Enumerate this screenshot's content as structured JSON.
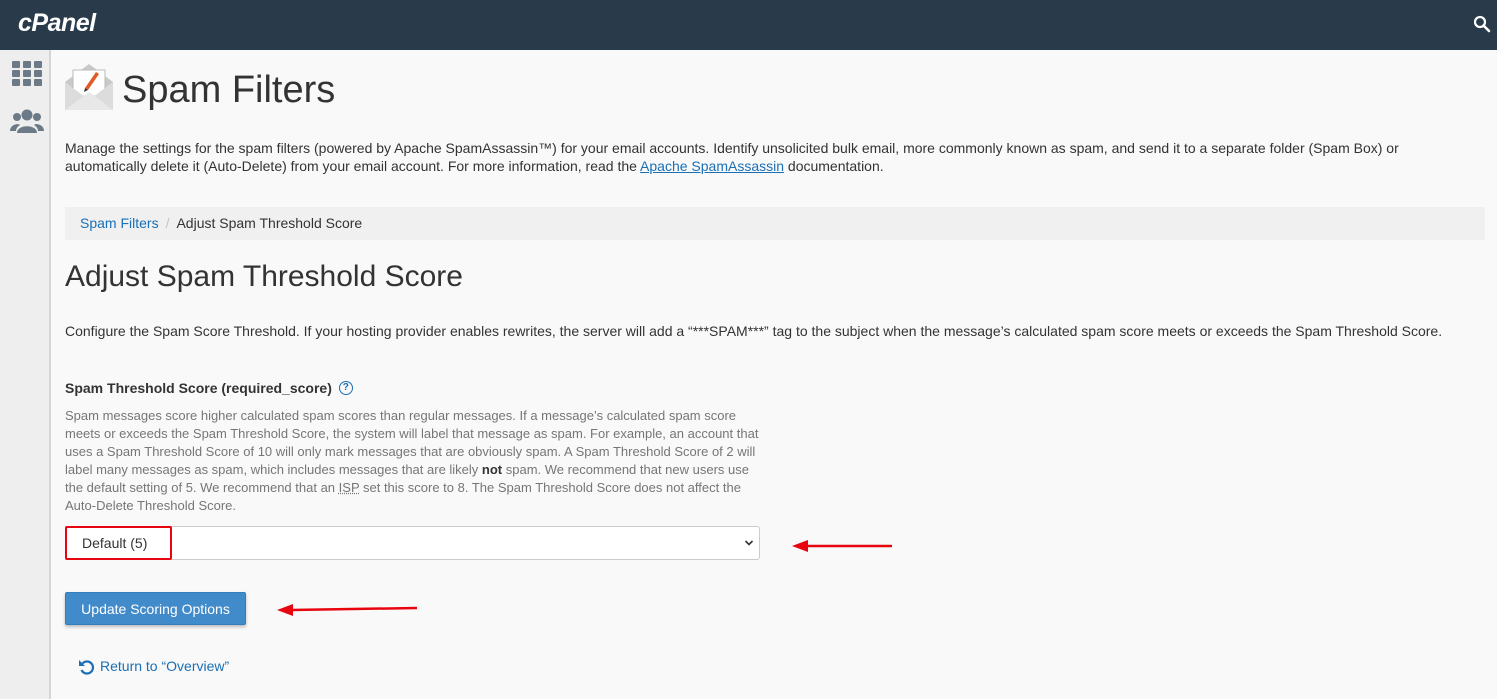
{
  "topbar": {
    "logo": "cPanel",
    "search_icon": "search-icon"
  },
  "sidebar": {
    "icons": [
      "grid-icon",
      "users-icon"
    ]
  },
  "page": {
    "title": "Spam Filters",
    "icon": "envelope-spam-icon",
    "intro_text": "Manage the settings for the spam filters (powered by Apache SpamAssassin™) for your email accounts. Identify unsolicited bulk email, more commonly known as spam, and send it to a separate folder (Spam Box) or automatically delete it (Auto-Delete) from your email account. For more information, read the ",
    "intro_link": "Apache SpamAssassin",
    "intro_suffix": " documentation."
  },
  "breadcrumb": {
    "parent": "Spam Filters",
    "separator": "/",
    "current": "Adjust Spam Threshold Score"
  },
  "section": {
    "title": "Adjust Spam Threshold Score",
    "description": "Configure the Spam Score Threshold. If your hosting provider enables rewrites, the server will add a “***SPAM***” tag to the subject when the message’s calculated spam score meets or exceeds the Spam Threshold Score."
  },
  "field": {
    "label": "Spam Threshold Score (required_score)",
    "help_icon": "?",
    "help_part1": "Spam messages score higher calculated spam scores than regular messages. If a message’s calculated spam score meets or exceeds the Spam Threshold Score, the system will label that message as spam. For example, an account that uses a Spam Threshold Score of 10 will only mark messages that are obviously spam. A Spam Threshold Score of 2 will label many messages as spam, which includes messages that are likely ",
    "help_bold": "not",
    "help_part2": " spam. We recommend that new users use the default setting of 5. We recommend that an ",
    "help_abbr": "ISP",
    "help_part3": " set this score to 8. The Spam Threshold Score does not affect the Auto-Delete Threshold Score.",
    "selected_value": "Default (5)"
  },
  "actions": {
    "update_button": "Update Scoring Options",
    "return_link": "Return to “Overview”"
  },
  "annotations": {
    "highlight_color": "#e8050f",
    "arrow_color": "#e8050f"
  }
}
